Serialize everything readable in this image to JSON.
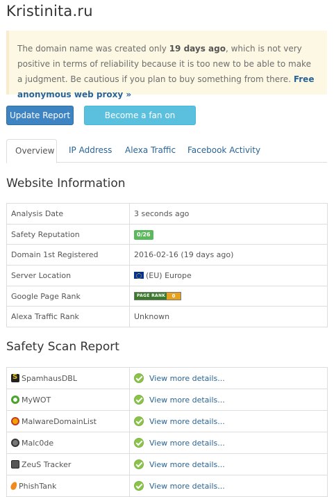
{
  "site": {
    "title": "Kristinita.ru"
  },
  "warning": {
    "text_before": "The domain name was created only ",
    "days": "19 days ago",
    "text_after": ", which is not very positive in terms of reliability because it is too new to be able to make a judgment. Be cautious if you plan to buy something from there. ",
    "link": "Free anonymous web proxy »"
  },
  "buttons": {
    "update": "Update Report",
    "facebook": "Become a fan on Facebook"
  },
  "tabs": [
    {
      "label": "Overview",
      "active": true
    },
    {
      "label": "IP Address",
      "active": false
    },
    {
      "label": "Alexa Traffic",
      "active": false
    },
    {
      "label": "Facebook Activity",
      "active": false
    }
  ],
  "website_info": {
    "title": "Website Information",
    "rows": [
      {
        "label": "Analysis Date",
        "value": "3 seconds ago"
      },
      {
        "label": "Safety Reputation",
        "value": "0/26"
      },
      {
        "label": "Domain 1st Registered",
        "value": "2016-02-16 (19 days ago)"
      },
      {
        "label": "Server Location",
        "value": "(EU) Europe"
      },
      {
        "label": "Google Page Rank",
        "value": "PAGE RANK",
        "rank": "0"
      },
      {
        "label": "Alexa Traffic Rank",
        "value": "Unknown"
      }
    ]
  },
  "safety_scan": {
    "title": "Safety Scan Report",
    "link_label": "View more details...",
    "rows": [
      {
        "name": "SpamhausDBL",
        "icon": "spamhaus-icon"
      },
      {
        "name": "MyWOT",
        "icon": "mywot-icon"
      },
      {
        "name": "MalwareDomainList",
        "icon": "malwaredomainlist-icon"
      },
      {
        "name": "Malc0de",
        "icon": "malc0de-icon"
      },
      {
        "name": "ZeuS Tracker",
        "icon": "zeus-tracker-icon"
      },
      {
        "name": "PhishTank",
        "icon": "phishtank-icon"
      }
    ]
  },
  "colors": {
    "link": "#2a6496",
    "primary": "#3f84c2",
    "info": "#5bc0de",
    "success": "#5cb85c",
    "warning_bg": "#fcf8e3"
  }
}
